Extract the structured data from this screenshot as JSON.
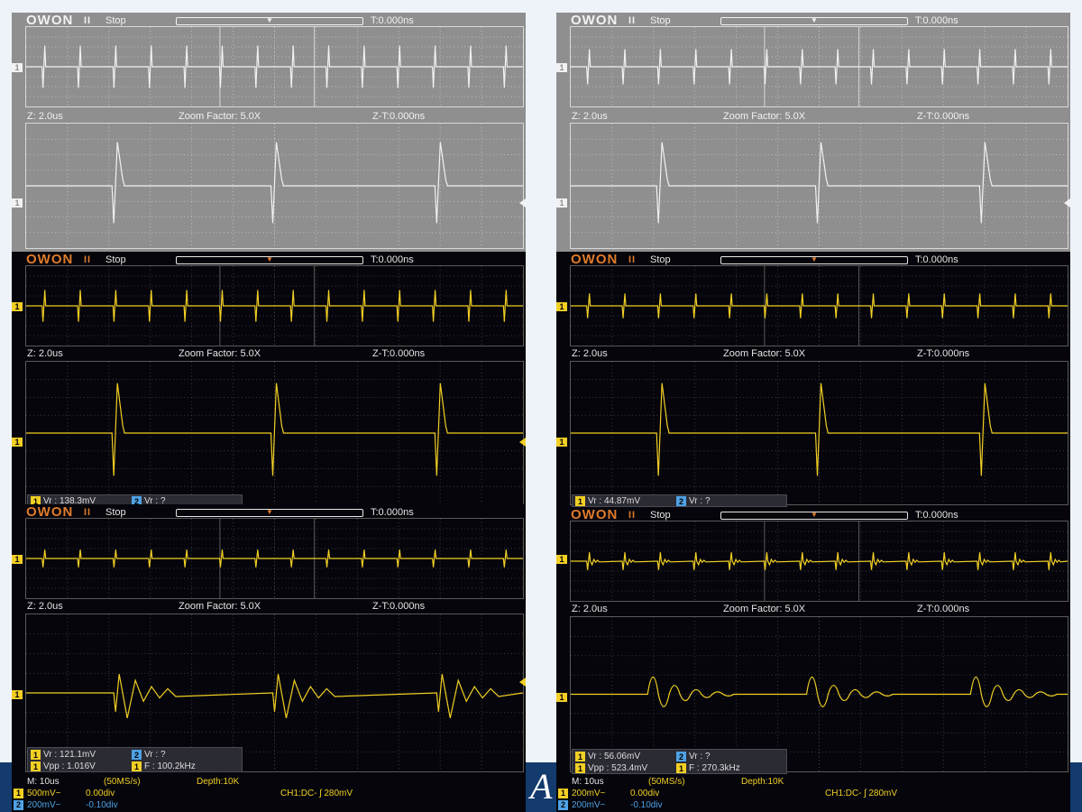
{
  "theme": {
    "grey_bg": "#8f8f8f",
    "grey_trace": "#f2f2f2",
    "dark_bg": "#05050b",
    "yellow_trace": "#f2cf24",
    "brand_orange": "#e07b2a",
    "band_blue": "#133b6d",
    "ch2_blue": "#4ea2e6"
  },
  "left": {
    "grey": {
      "logo": "OWON",
      "pause": "II",
      "run_state": "Stop",
      "t_offset": "T:0.000ns",
      "zoom_scale": "Z: 2.0us",
      "zoom_factor": "Zoom Factor: 5.0X",
      "zoom_offset": "Z-T:0.000ns"
    },
    "yellow": {
      "logo": "OWON",
      "pause": "II",
      "run_state": "Stop",
      "t_offset": "T:0.000ns",
      "zoom_scale": "Z: 2.0us",
      "zoom_factor": "Zoom Factor: 5.0X",
      "zoom_offset": "Z-T:0.000ns",
      "meas": {
        "ch1": "1",
        "ch1_text": "Vr : 138.3mV",
        "ch2": "2",
        "ch2_text": "Vr :     ?"
      }
    },
    "ring": {
      "logo": "OWON",
      "pause": "II",
      "run_state": "Stop",
      "t_offset": "T:0.000ns",
      "zoom_scale": "Z: 2.0us",
      "zoom_factor": "Zoom Factor: 5.0X",
      "zoom_offset": "Z-T:0.000ns",
      "meas": {
        "ch1": "1",
        "ch1_text": "Vr : 121.1mV",
        "ch2": "2",
        "ch2_text": "Vr :     ?",
        "ch1b": "1",
        "ch1b_text": "Vpp : 1.016V",
        "ch1c": "1",
        "ch1c_text": "F : 100.2kHz"
      }
    },
    "footer": {
      "timebase": "M: 10us",
      "sample_rate": "(50MS/s)",
      "depth": "Depth:10K",
      "ch1_badge": "1",
      "ch1_scale": "500mV~",
      "ch1_pos": "0.00div",
      "ch2_badge": "2",
      "ch2_scale": "200mV~",
      "ch2_pos": "-0.10div",
      "trigger": "CH1:DC- ʃ 280mV"
    }
  },
  "right": {
    "grey": {
      "logo": "OWON",
      "pause": "II",
      "run_state": "Stop",
      "t_offset": "T:0.000ns",
      "zoom_scale": "Z: 2.0us",
      "zoom_factor": "Zoom Factor: 5.0X",
      "zoom_offset": "Z-T:0.000ns"
    },
    "yellow": {
      "logo": "OWON",
      "pause": "II",
      "run_state": "Stop",
      "t_offset": "T:0.000ns",
      "zoom_scale": "Z: 2.0us",
      "zoom_factor": "Zoom Factor: 5.0X",
      "zoom_offset": "Z-T:0.000ns",
      "meas": {
        "ch1": "1",
        "ch1_text": "Vr : 44.87mV",
        "ch2": "2",
        "ch2_text": "Vr :     ?"
      }
    },
    "ring": {
      "logo": "OWON",
      "pause": "II",
      "run_state": "Stop",
      "t_offset": "T:0.000ns",
      "zoom_scale": "Z: 2.0us",
      "zoom_factor": "Zoom Factor: 5.0X",
      "zoom_offset": "Z-T:0.000ns",
      "meas": {
        "ch1": "1",
        "ch1_text": "Vr : 56.06mV",
        "ch2": "2",
        "ch2_text": "Vr :     ?",
        "ch1b": "1",
        "ch1b_text": "Vpp : 523.4mV",
        "ch1c": "1",
        "ch1c_text": "F : 270.3kHz"
      }
    },
    "footer": {
      "timebase": "M: 10us",
      "sample_rate": "(50MS/s)",
      "depth": "Depth:10K",
      "ch1_badge": "1",
      "ch1_scale": "200mV~",
      "ch1_pos": "0.00div",
      "ch2_badge": "2",
      "ch2_scale": "200mV~",
      "ch2_pos": "-0.10div",
      "trigger": "CH1:DC- ʃ 280mV"
    }
  },
  "markers": {
    "ch1": "1",
    "trigger": "T",
    "pointer": "▼"
  },
  "corner_logo": "A"
}
